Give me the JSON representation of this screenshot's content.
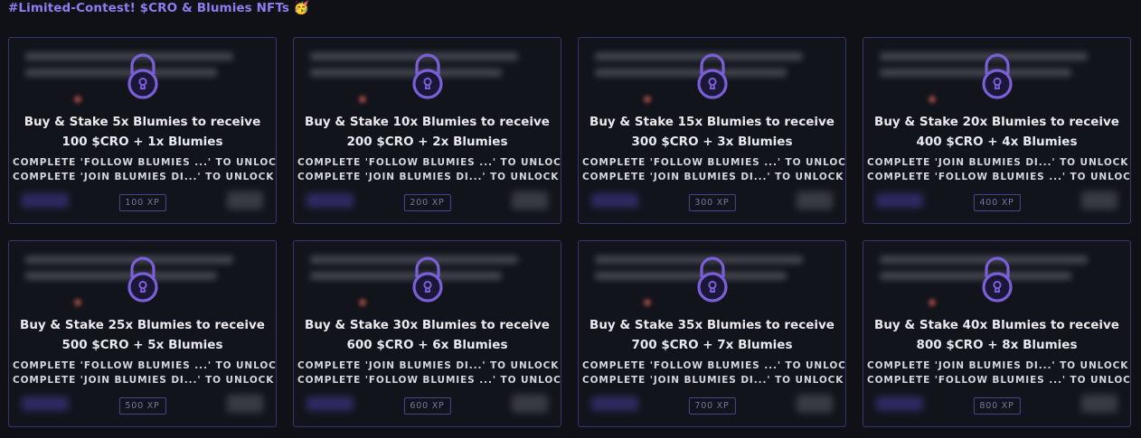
{
  "page": {
    "title": "#Limited-Contest! $CRO & Blumies NFTs",
    "title_emoji": "🥳"
  },
  "colors": {
    "background": "#0f1116",
    "accent": "#8f7cf0",
    "card_border": "#3a3470",
    "lock": "#7b5fd8"
  },
  "cards": [
    {
      "title": "Buy & Stake 5x Blumies to receive 100 $CRO + 1x Blumies",
      "req1": "COMPLETE 'FOLLOW BLUMIES ...' TO UNLOCK +",
      "req2": "COMPLETE 'JOIN BLUMIES DI...' TO UNLOCK",
      "xp": "100 XP",
      "icon": "lock-icon"
    },
    {
      "title": "Buy & Stake 10x Blumies to receive 200 $CRO + 2x Blumies",
      "req1": "COMPLETE 'FOLLOW BLUMIES ...' TO UNLOCK +",
      "req2": "COMPLETE 'JOIN BLUMIES DI...' TO UNLOCK",
      "xp": "200 XP",
      "icon": "lock-icon"
    },
    {
      "title": "Buy & Stake 15x Blumies to receive 300 $CRO + 3x Blumies",
      "req1": "COMPLETE 'FOLLOW BLUMIES ...' TO UNLOCK +",
      "req2": "COMPLETE 'JOIN BLUMIES DI...' TO UNLOCK",
      "xp": "300 XP",
      "icon": "lock-icon"
    },
    {
      "title": "Buy & Stake 20x Blumies to receive 400 $CRO + 4x Blumies",
      "req1": "COMPLETE 'JOIN BLUMIES DI...' TO UNLOCK +",
      "req2": "COMPLETE 'FOLLOW BLUMIES ...' TO UNLOCK",
      "xp": "400 XP",
      "icon": "lock-icon"
    },
    {
      "title": "Buy & Stake 25x Blumies to receive 500 $CRO + 5x Blumies",
      "req1": "COMPLETE 'FOLLOW BLUMIES ...' TO UNLOCK +",
      "req2": "COMPLETE 'JOIN BLUMIES DI...' TO UNLOCK",
      "xp": "500 XP",
      "icon": "lock-icon"
    },
    {
      "title": "Buy & Stake 30x Blumies to receive 600 $CRO + 6x Blumies",
      "req1": "COMPLETE 'JOIN BLUMIES DI...' TO UNLOCK +",
      "req2": "COMPLETE 'FOLLOW BLUMIES ...' TO UNLOCK",
      "xp": "600 XP",
      "icon": "lock-icon"
    },
    {
      "title": "Buy & Stake 35x Blumies to receive 700 $CRO + 7x Blumies",
      "req1": "COMPLETE 'FOLLOW BLUMIES ...' TO UNLOCK +",
      "req2": "COMPLETE 'JOIN BLUMIES DI...' TO UNLOCK",
      "xp": "700 XP",
      "icon": "lock-icon"
    },
    {
      "title": "Buy & Stake 40x Blumies to receive 800 $CRO + 8x Blumies",
      "req1": "COMPLETE 'JOIN BLUMIES DI...' TO UNLOCK +",
      "req2": "COMPLETE 'FOLLOW BLUMIES ...' TO UNLOCK",
      "xp": "800 XP",
      "icon": "lock-icon"
    }
  ]
}
